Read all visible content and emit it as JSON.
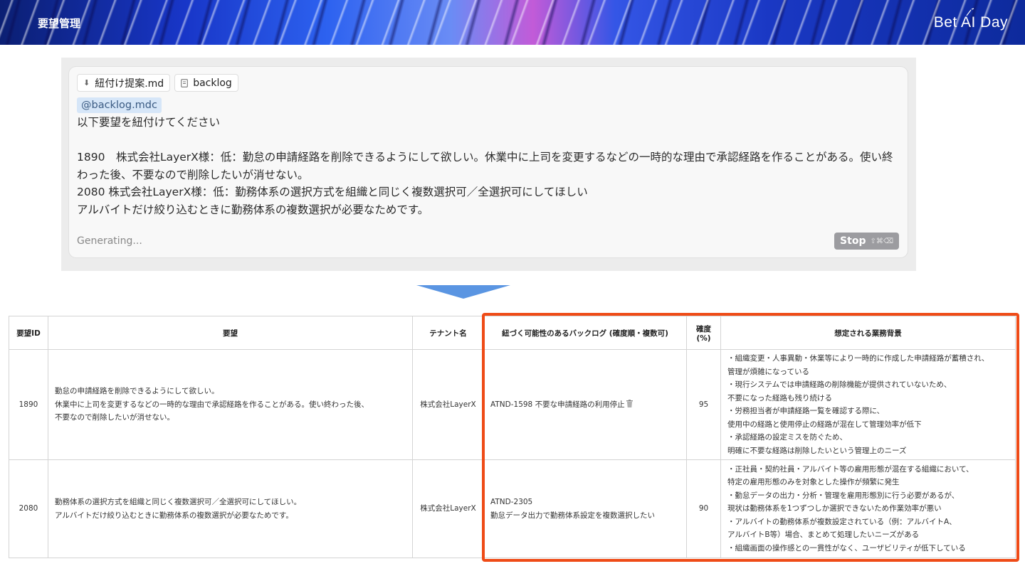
{
  "header": {
    "title": "要望管理",
    "brand": "Bet AI Day"
  },
  "chat": {
    "chips": [
      {
        "icon": "download-icon",
        "label": "紐付け提案.md"
      },
      {
        "icon": "file-icon",
        "label": "backlog"
      }
    ],
    "mention": "@backlog.mdc",
    "prompt": "以下要望を紐付けてください\n\n1890　株式会社LayerX様：低：勤怠の申請経路を削除できるようにして欲しい。休業中に上司を変更するなどの一時的な理由で承認経路を作ることがある。使い終わった後、不要なので削除したいが消せない。\n2080 株式会社LayerX様：低：勤務体系の選択方式を組織と同じく複数選択可／全選択可にしてほしい\nアルバイトだけ絞り込むときに勤務体系の複数選択が必要なためです。",
    "status": "Generating...",
    "stop_label": "Stop",
    "stop_shortcut": "⇧⌘⌫"
  },
  "table": {
    "headers": [
      "要望ID",
      "要望",
      "テナント名",
      "紐づく可能性のあるバックログ (確度順・複数可)",
      "確度\n(%)",
      "想定される業務背景"
    ],
    "confidence_header_line1": "確度",
    "confidence_header_line2": "(%)",
    "rows": [
      {
        "id": "1890",
        "request_lines": [
          "勤怠の申請経路を削除できるようにして欲しい。",
          "休業中に上司を変更するなどの一時的な理由で承認経路を作ることがある。使い終わった後、",
          "不要なので削除したいが消せない。"
        ],
        "tenant": "株式会社LayerX",
        "backlog_lines": [
          "ATND-1598 不要な申請経路の利用停止"
        ],
        "backlog_icon": "trash-icon",
        "confidence": "95",
        "background_lines": [
          "・組織変更・人事異動・休業等により一時的に作成した申請経路が蓄積され、",
          "管理が煩雑になっている",
          "・現行システムでは申請経路の削除機能が提供されていないため、",
          "不要になった経路も残り続ける",
          "・労務担当者が申請経路一覧を確認する際に、",
          "使用中の経路と使用停止の経路が混在して管理効率が低下",
          "・承認経路の設定ミスを防ぐため、",
          "明確に不要な経路は削除したいという管理上のニーズ"
        ]
      },
      {
        "id": "2080",
        "request_lines": [
          "勤務体系の選択方式を組織と同じく複数選択可／全選択可にしてほしい。",
          "アルバイトだけ絞り込むときに勤務体系の複数選択が必要なためです。"
        ],
        "tenant": "株式会社LayerX",
        "backlog_lines": [
          "ATND-2305",
          "勤怠データ出力で勤務体系設定を複数選択したい"
        ],
        "confidence": "90",
        "background_lines": [
          "・正社員・契約社員・アルバイト等の雇用形態が混在する組織において、",
          "特定の雇用形態のみを対象とした操作が頻繁に発生",
          "・勤怠データの出力・分析・管理を雇用形態別に行う必要があるが、",
          "現状は勤務体系を1つずつしか選択できないため作業効率が悪い",
          "・アルバイトの勤務体系が複数設定されている（例：アルバイトA、",
          "アルバイトB等）場合、まとめて処理したいニーズがある",
          "・組織画面の操作感との一貫性がなく、ユーザビリティが低下している"
        ]
      }
    ]
  },
  "colors": {
    "highlight": "#ef4b17",
    "arrow": "#5a95e2",
    "mention_bg": "#d6e6f8"
  }
}
